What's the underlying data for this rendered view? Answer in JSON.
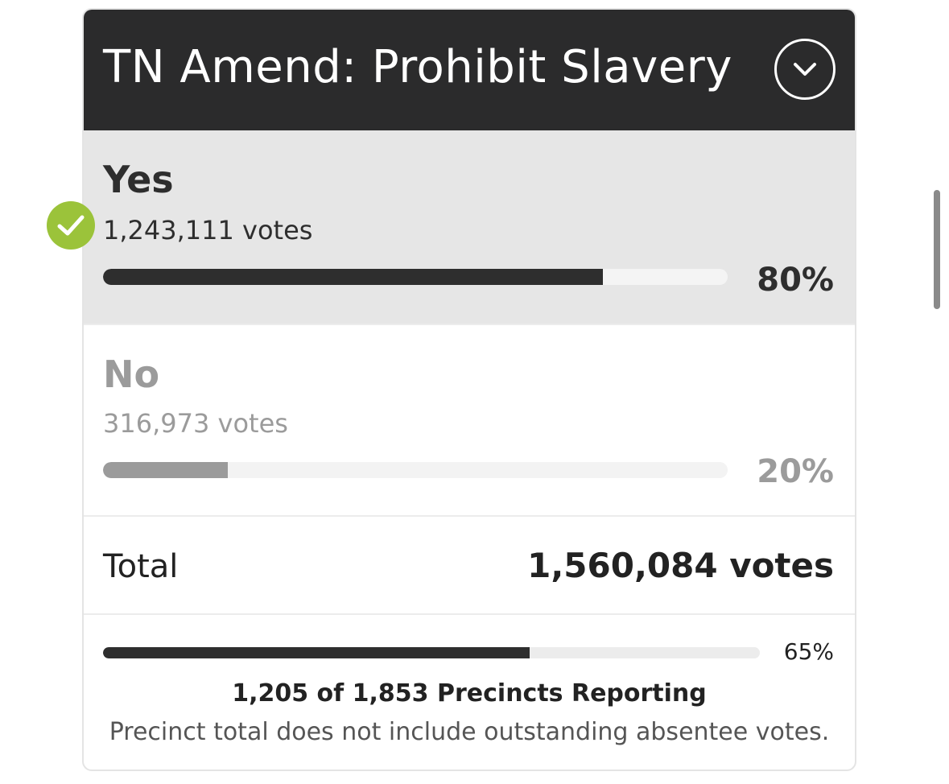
{
  "race": {
    "title": "TN Amend: Prohibit Slavery",
    "toggle_icon": "chevron-down-icon"
  },
  "options": [
    {
      "name": "Yes",
      "votes": "1,243,111 votes",
      "percent": "80%",
      "share": 0.8,
      "winner": true,
      "winner_icon": "checkmark-icon",
      "color": "#2e2e2e"
    },
    {
      "name": "No",
      "votes": "316,973 votes",
      "percent": "20%",
      "share": 0.2,
      "winner": false,
      "color": "#9b9b9b"
    }
  ],
  "total": {
    "label": "Total",
    "value": "1,560,084 votes"
  },
  "precincts": {
    "percent": "65%",
    "share": 0.65,
    "reporting": "1,205 of 1,853 Precincts Reporting",
    "note": "Precinct total does not include outstanding absentee votes."
  },
  "colors": {
    "header_bg": "#2b2b2c",
    "winner_check": "#9bc33a",
    "winner_row_bg": "#e6e6e6"
  }
}
